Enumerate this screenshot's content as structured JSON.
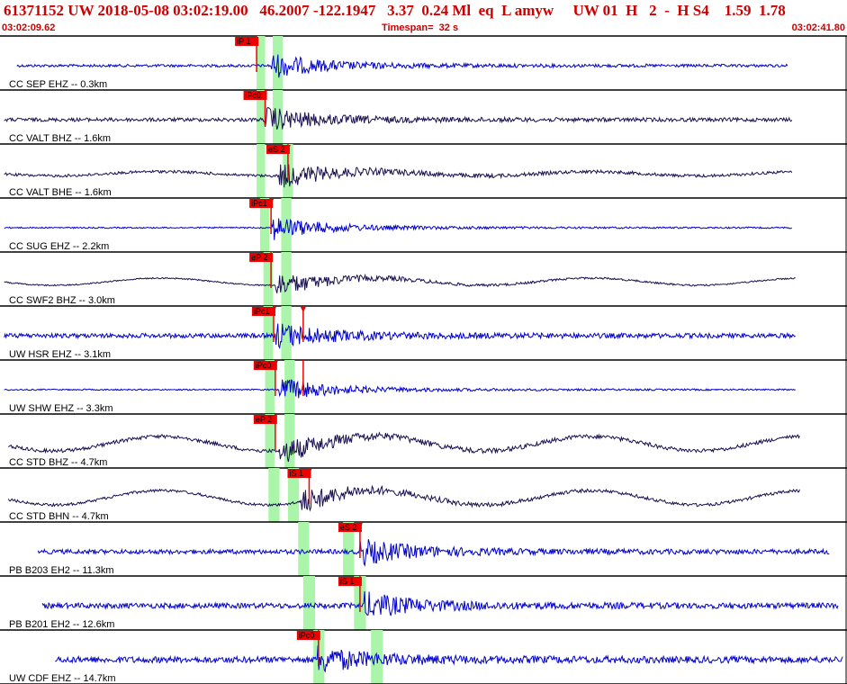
{
  "header": {
    "title_line": "61371152 UW 2018-05-08 03:02:19.00   46.2007 -122.1947   3.37  0.24 Ml  eq  L amyw     UW 01  H   2  -  H S4    1.59  1.78",
    "start_time": "03:02:09.62",
    "timespan": "Timespan=  32 s",
    "end_time": "03:02:41.80"
  },
  "colors": {
    "header_text": "#cc0000",
    "trace_blue": "#0000cc",
    "trace_dark": "#1a1050",
    "pick_red": "#ee0000",
    "window_green": "#aaf5aa",
    "divider": "#000000"
  },
  "traces": [
    {
      "label": "CC SEP EHZ -- 0.3km",
      "color": "blue",
      "start": 0.02,
      "end": 0.93,
      "amp": 3,
      "lowfreq": 0,
      "onset": 0.32,
      "picks": [
        {
          "text": "iP 1",
          "t": 0.303,
          "marker": false
        }
      ],
      "windows": [
        [
          0.303,
          0.313
        ],
        [
          0.322,
          0.334
        ]
      ]
    },
    {
      "label": "CC VALT BHZ -- 1.6km",
      "color": "dark",
      "start": 0.005,
      "end": 0.935,
      "amp": 4,
      "lowfreq": 0,
      "onset": 0.313,
      "picks": [
        {
          "text": "iPc0",
          "t": 0.313,
          "marker": false
        }
      ],
      "windows": [
        [
          0.303,
          0.313
        ],
        [
          0.322,
          0.334
        ]
      ]
    },
    {
      "label": "CC VALT BHE -- 1.6km",
      "color": "dark",
      "start": 0.005,
      "end": 0.935,
      "amp": 3,
      "lowfreq": 3,
      "onset": 0.33,
      "picks": [
        {
          "text": "eS 2",
          "t": 0.34,
          "marker": true
        }
      ],
      "windows": [
        [
          0.303,
          0.313
        ],
        [
          0.334,
          0.346
        ]
      ]
    },
    {
      "label": "CC SUG EHZ -- 2.2km",
      "color": "blue",
      "start": 0.005,
      "end": 0.935,
      "amp": 1.5,
      "lowfreq": 0,
      "onset": 0.32,
      "picks": [
        {
          "text": "iPc1",
          "t": 0.32,
          "marker": true
        }
      ],
      "windows": [
        [
          0.307,
          0.318
        ],
        [
          0.332,
          0.344
        ]
      ]
    },
    {
      "label": "CC SWF2 BHZ -- 3.0km",
      "color": "dark",
      "start": 0.005,
      "end": 0.94,
      "amp": 1.5,
      "lowfreq": 5,
      "onset": 0.325,
      "picks": [
        {
          "text": "eP 2",
          "t": 0.32,
          "marker": false
        }
      ],
      "windows": [
        [
          0.311,
          0.322
        ],
        [
          0.332,
          0.344
        ]
      ]
    },
    {
      "label": "UW HSR EHZ -- 3.1km",
      "color": "blue",
      "start": 0.005,
      "end": 0.94,
      "amp": 5,
      "lowfreq": 0,
      "onset": 0.325,
      "picks": [
        {
          "text": "iPc1",
          "t": 0.323,
          "marker": true
        },
        {
          "text": "",
          "t": 0.358,
          "marker": true
        }
      ],
      "windows": [
        [
          0.311,
          0.322
        ],
        [
          0.332,
          0.344
        ]
      ]
    },
    {
      "label": "UW SHW EHZ -- 3.3km",
      "color": "blue",
      "start": 0.005,
      "end": 0.94,
      "amp": 1.5,
      "lowfreq": 0,
      "onset": 0.33,
      "picks": [
        {
          "text": "iPc0",
          "t": 0.325,
          "marker": true
        },
        {
          "text": "",
          "t": 0.358,
          "marker": false
        }
      ],
      "windows": [
        [
          0.313,
          0.324
        ],
        [
          0.336,
          0.348
        ]
      ]
    },
    {
      "label": "CC STD BHZ -- 4.7km",
      "color": "dark",
      "start": 0.01,
      "end": 0.945,
      "amp": 4,
      "lowfreq": 10,
      "onset": 0.33,
      "picks": [
        {
          "text": "eP 2",
          "t": 0.325,
          "marker": false
        }
      ],
      "windows": [
        [
          0.313,
          0.324
        ],
        [
          0.336,
          0.348
        ]
      ]
    },
    {
      "label": "CC STD BHN -- 4.7km",
      "color": "dark",
      "start": 0.01,
      "end": 0.945,
      "amp": 3,
      "lowfreq": 10,
      "onset": 0.355,
      "picks": [
        {
          "text": "iS 1",
          "t": 0.365,
          "marker": true
        }
      ],
      "windows": [
        [
          0.317,
          0.33
        ],
        [
          0.34,
          0.353
        ]
      ]
    },
    {
      "label": "PB B203 EH2 -- 11.3km",
      "color": "blue",
      "start": 0.045,
      "end": 0.98,
      "amp": 5,
      "lowfreq": 0,
      "onset": 0.425,
      "picks": [
        {
          "text": "eS 2",
          "t": 0.425,
          "marker": true
        }
      ],
      "windows": [
        [
          0.352,
          0.365
        ],
        [
          0.405,
          0.418
        ]
      ]
    },
    {
      "label": "PB B201 EH2 -- 12.6km",
      "color": "blue",
      "start": 0.05,
      "end": 0.99,
      "amp": 6,
      "lowfreq": 0,
      "onset": 0.43,
      "picks": [
        {
          "text": "iS 1",
          "t": 0.425,
          "marker": false
        }
      ],
      "windows": [
        [
          0.358,
          0.372
        ],
        [
          0.418,
          0.432
        ]
      ]
    },
    {
      "label": "UW CDF EHZ -- 14.7km",
      "color": "blue",
      "start": 0.065,
      "end": 0.995,
      "amp": 7,
      "lowfreq": 0,
      "onset": 0.375,
      "picks": [
        {
          "text": "iPc0",
          "t": 0.376,
          "marker": false
        }
      ],
      "windows": [
        [
          0.37,
          0.383
        ],
        [
          0.438,
          0.452
        ]
      ]
    }
  ]
}
